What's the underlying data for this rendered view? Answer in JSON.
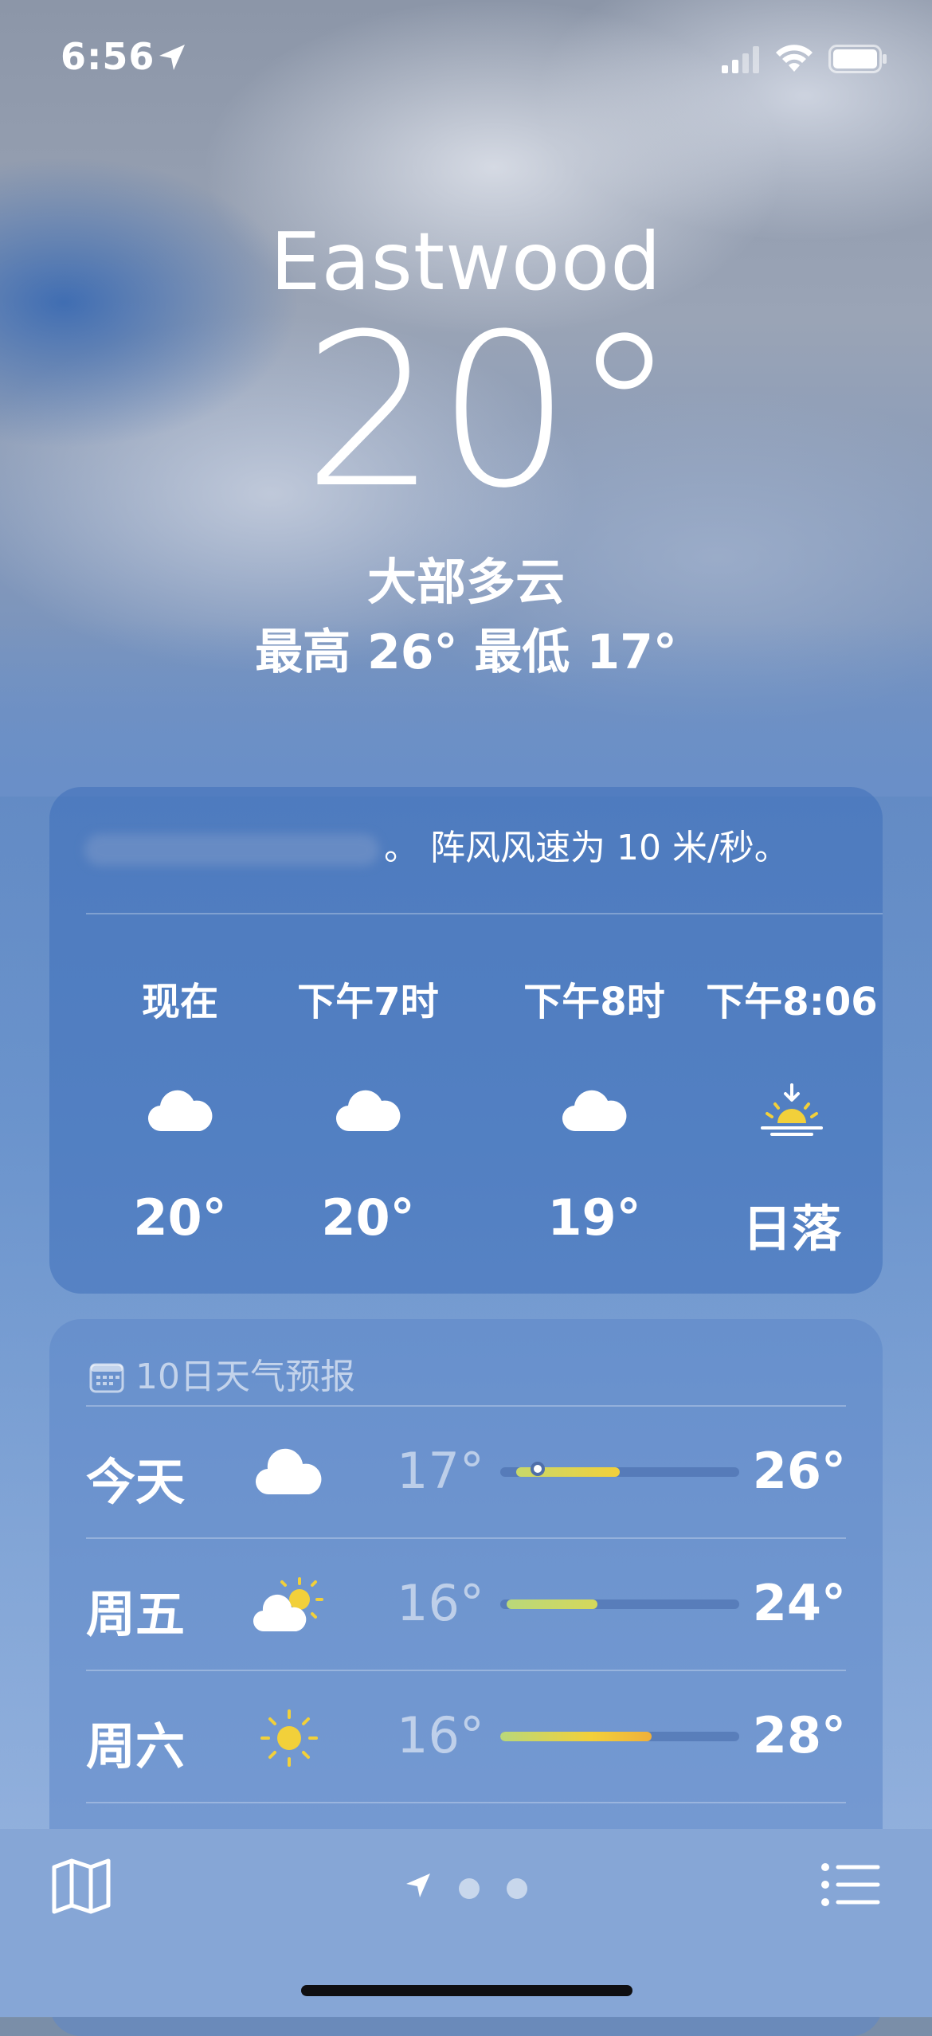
{
  "status_bar": {
    "time": "6:56"
  },
  "location": {
    "city": "Eastwood",
    "temperature": "20°",
    "condition": "大部多云",
    "high_low": "最高 26°  最低 17°"
  },
  "hourly": {
    "summary": "。 阵风风速为 10 米/秒。",
    "items": [
      {
        "label": "现在",
        "icon": "cloud-icon",
        "value": "20°"
      },
      {
        "label": "下午7时",
        "icon": "cloud-icon",
        "value": "20°"
      },
      {
        "label": "下午8时",
        "icon": "cloud-icon",
        "value": "19°"
      },
      {
        "label": "下午8:06",
        "icon": "sunset-icon",
        "value": "日落"
      }
    ]
  },
  "daily": {
    "title": "10日天气预报",
    "days": [
      {
        "name": "今天",
        "icon": "cloud-icon",
        "low": "17°",
        "high": "26°",
        "current_marker": true
      },
      {
        "name": "周五",
        "icon": "partly-sunny-icon",
        "low": "16°",
        "high": "24°"
      },
      {
        "name": "周六",
        "icon": "sun-icon",
        "low": "16°",
        "high": "28°"
      }
    ]
  },
  "colors": {
    "accent_yellow": "#f2d03a",
    "accent_green": "#c3d86a",
    "accent_orange": "#f0b03a"
  }
}
